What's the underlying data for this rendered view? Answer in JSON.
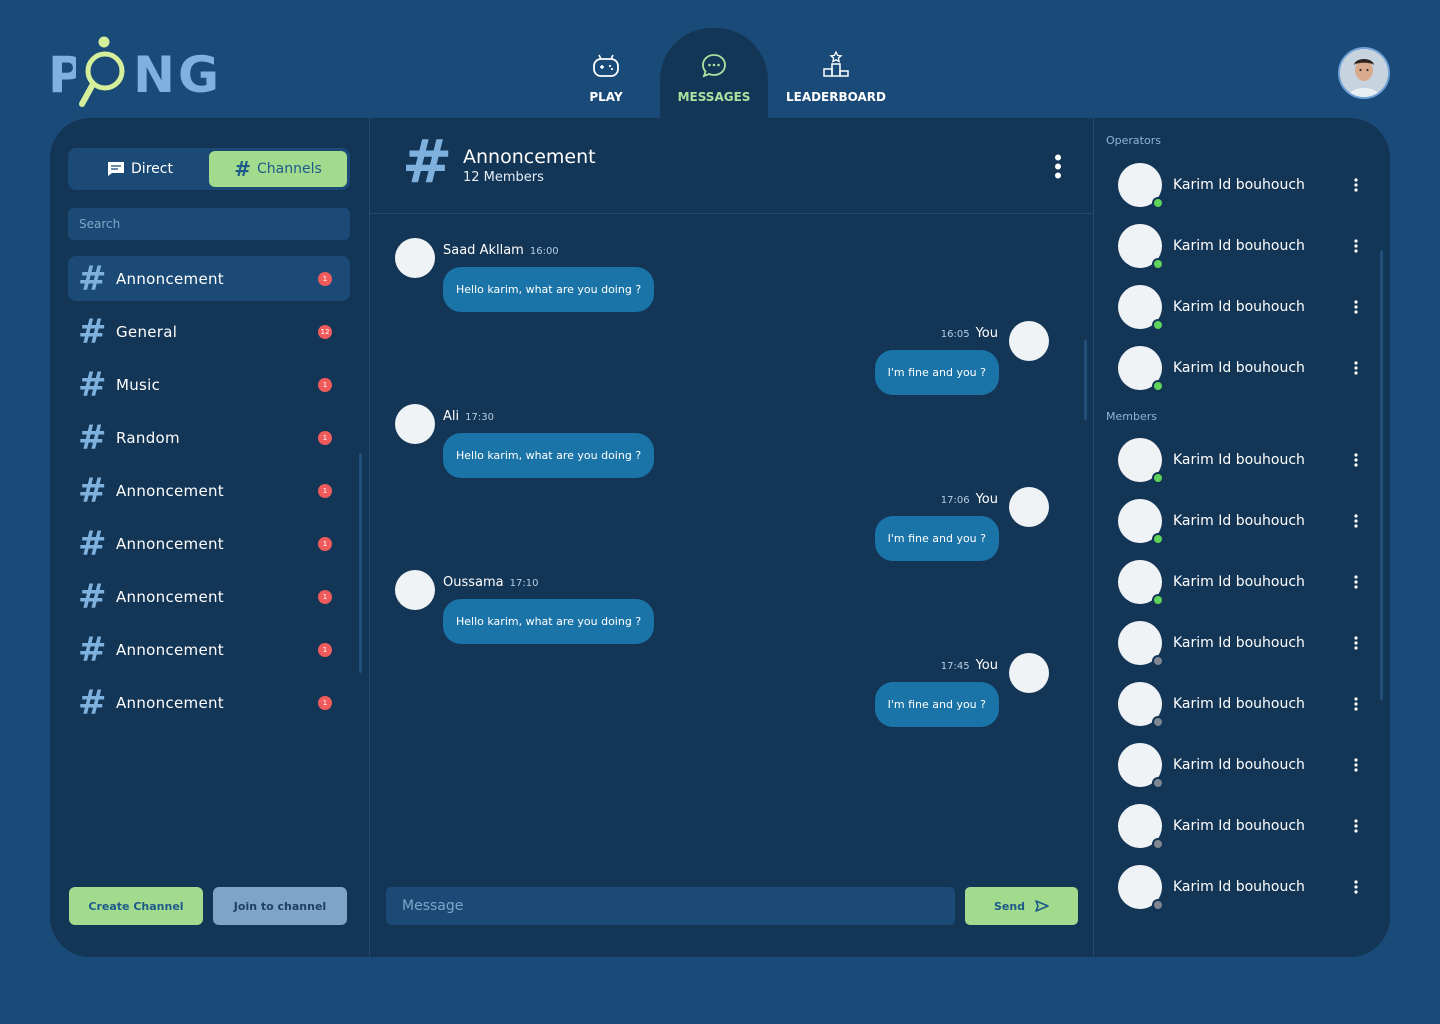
{
  "app": {
    "logo": "PONG",
    "nav": [
      {
        "label": "PLAY",
        "icon": "gamepad-icon"
      },
      {
        "label": "MESSAGES",
        "icon": "chat-icon"
      },
      {
        "label": "LEADERBOARD",
        "icon": "podium-icon"
      }
    ]
  },
  "sidebar": {
    "tabs": {
      "direct": "Direct",
      "channels": "Channels"
    },
    "search_placeholder": "Search",
    "channels": [
      {
        "name": "Annoncement",
        "badge": "1"
      },
      {
        "name": "General",
        "badge": "12"
      },
      {
        "name": "Music",
        "badge": "1"
      },
      {
        "name": "Random",
        "badge": "1"
      },
      {
        "name": "Annoncement",
        "badge": "1"
      },
      {
        "name": "Annoncement",
        "badge": "1"
      },
      {
        "name": "Annoncement",
        "badge": "1"
      },
      {
        "name": "Annoncement",
        "badge": "1"
      },
      {
        "name": "Annoncement",
        "badge": "1"
      }
    ],
    "create_label": "Create Channel",
    "join_label": "Join to channel"
  },
  "chat": {
    "hash": "#",
    "title": "Annoncement",
    "members": "12 Members",
    "messages": [
      {
        "name": "Saad Akllam",
        "time": "16:00",
        "text": "Hello karim, what are you doing ?"
      },
      {
        "name": "You",
        "time": "16:05",
        "text": "I'm fine and you ?"
      },
      {
        "name": "Ali",
        "time": "17:30",
        "text": "Hello karim, what are you doing ?"
      },
      {
        "name": "You",
        "time": "17:06",
        "text": "I'm fine and you ?"
      },
      {
        "name": "Oussama",
        "time": "17:10",
        "text": "Hello karim, what are you doing ?"
      },
      {
        "name": "You",
        "time": "17:45",
        "text": "I'm fine and you ?"
      }
    ],
    "input_placeholder": "Message",
    "send_label": "Send"
  },
  "members_panel": {
    "operators_label": "Operators",
    "members_label": "Members",
    "operators": [
      {
        "name": "Karim Id bouhouch",
        "status": "online"
      },
      {
        "name": "Karim Id bouhouch",
        "status": "online"
      },
      {
        "name": "Karim Id bouhouch",
        "status": "online"
      },
      {
        "name": "Karim Id bouhouch",
        "status": "online"
      }
    ],
    "members": [
      {
        "name": "Karim Id bouhouch",
        "status": "online"
      },
      {
        "name": "Karim Id bouhouch",
        "status": "online"
      },
      {
        "name": "Karim Id bouhouch",
        "status": "online"
      },
      {
        "name": "Karim Id bouhouch",
        "status": "offline"
      },
      {
        "name": "Karim Id bouhouch",
        "status": "offline"
      },
      {
        "name": "Karim Id bouhouch",
        "status": "offline"
      },
      {
        "name": "Karim Id bouhouch",
        "status": "offline"
      },
      {
        "name": "Karim Id bouhouch",
        "status": "offline"
      }
    ]
  },
  "colors": {
    "background": "#1a4a78",
    "panel": "#133556",
    "accent": "#a2db8e",
    "bubble": "#1b74a8",
    "online": "#5fd45a",
    "offline": "#7d8691",
    "badge": "#ef5b5b"
  }
}
